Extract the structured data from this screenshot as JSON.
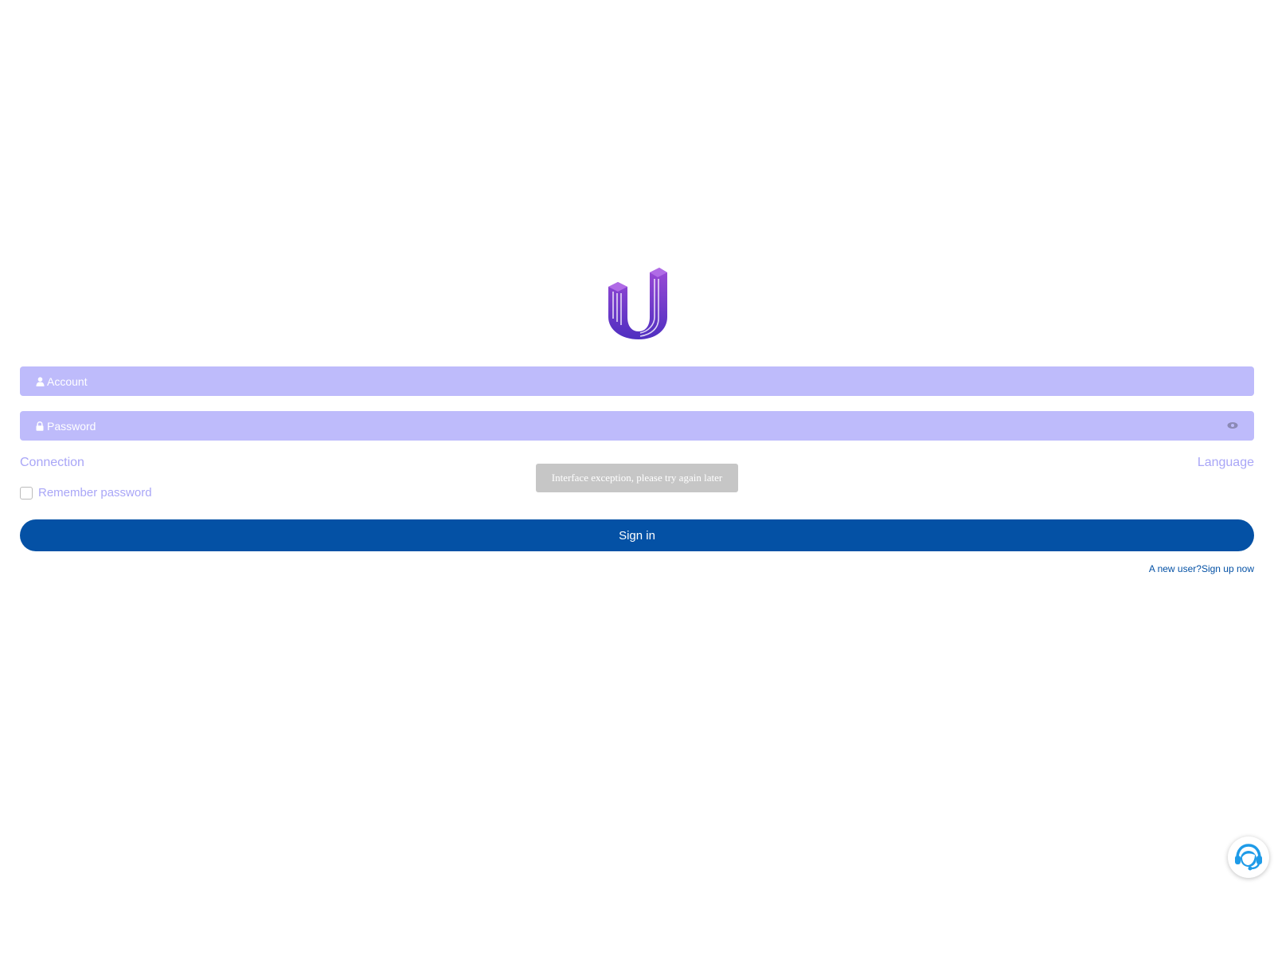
{
  "logo": {
    "icon": "brand-u-logo-icon",
    "colors": [
      "#8a3fd1",
      "#5a2fc4",
      "#6c3ad8"
    ]
  },
  "form": {
    "account": {
      "placeholder": "Account",
      "icon": "user-icon"
    },
    "password": {
      "placeholder": "Password",
      "icon": "lock-icon",
      "toggle_icon": "eye-icon"
    },
    "connection_label": "Connection",
    "language_label": "Language",
    "remember_label": "Remember password",
    "remember_checked": false,
    "signin_label": "Sign in",
    "signup_question": "A new user?",
    "signup_link": "Sign up now"
  },
  "toast": {
    "message": "Interface exception, please try again later"
  },
  "support": {
    "icon": "customer-service-icon",
    "color": "#1e9be8"
  },
  "colors": {
    "field_bg": "#bebbfb",
    "link_light": "#a9a6f7",
    "primary": "#0451a5",
    "toast_bg": "#c6c6c6"
  }
}
